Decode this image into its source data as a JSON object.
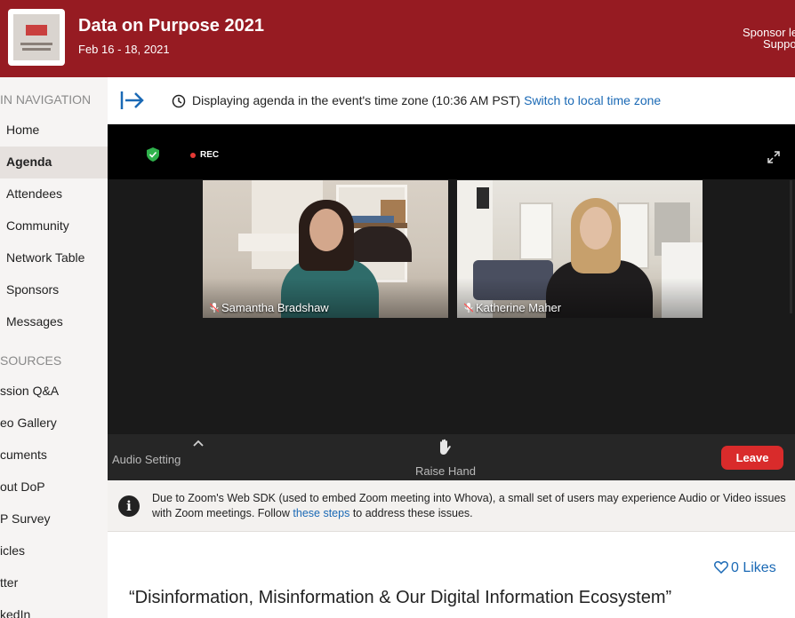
{
  "header": {
    "title": "Data on Purpose 2021",
    "dates": "Feb 16 - 18, 2021",
    "sponsor_line1": "Sponsor le",
    "sponsor_line2": "Suppo",
    "background_color": "#961b22"
  },
  "sidebar": {
    "nav_heading": "IN NAVIGATION",
    "nav_items": [
      {
        "label": "Home",
        "active": false
      },
      {
        "label": "Agenda",
        "active": true
      },
      {
        "label": "Attendees",
        "active": false
      },
      {
        "label": "Community",
        "active": false
      },
      {
        "label": "Network Table",
        "active": false
      },
      {
        "label": "Sponsors",
        "active": false
      },
      {
        "label": "Messages",
        "active": false
      }
    ],
    "resources_heading": "SOURCES",
    "resource_items": [
      {
        "label": "ssion Q&A"
      },
      {
        "label": "eo Gallery"
      },
      {
        "label": "cuments"
      },
      {
        "label": "out DoP"
      },
      {
        "label": "P Survey"
      },
      {
        "label": "icles"
      },
      {
        "label": "tter"
      },
      {
        "label": "kedIn"
      }
    ]
  },
  "timezone_bar": {
    "message": "Displaying agenda in the event's time zone (10:36 AM PST)",
    "link": "Switch to local time zone",
    "icon": "clock-icon"
  },
  "video": {
    "rec_label": "REC",
    "participants": [
      {
        "name": "Samantha Bradshaw"
      },
      {
        "name": "Katherine Maher"
      }
    ],
    "controls": {
      "audio_setting": "Audio Setting",
      "raise_hand": "Raise Hand",
      "leave": "Leave"
    },
    "leave_color": "#d92b2b",
    "shield_color": "#2fb24c"
  },
  "notice": {
    "text_before": "Due to Zoom's Web SDK (used to embed Zoom meeting into Whova), a small set of users may experience Audio or Video issues with Zoom meetings. Follow",
    "link": "these steps",
    "text_after": "to address these issues."
  },
  "session": {
    "likes": "0 Likes",
    "title": "“Disinformation, Misinformation & Our Digital Information Ecosystem”"
  },
  "colors": {
    "link": "#1a69b5",
    "sidebar_bg": "#f6f4f3",
    "active_item_bg": "#e6e1de"
  }
}
